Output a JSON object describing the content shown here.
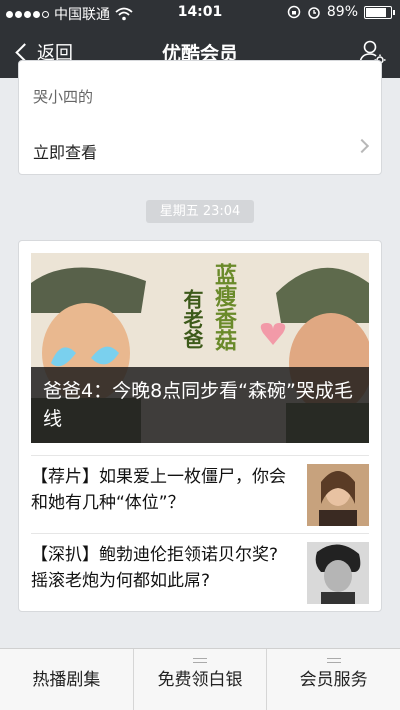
{
  "statusbar": {
    "carrier": "中国联通",
    "time": "14:01",
    "battery_text": "89%",
    "battery_level": 0.89,
    "icons": [
      "signal-dots-icon",
      "wifi-icon",
      "lock-rotation-icon",
      "alarm-icon",
      "battery-icon"
    ]
  },
  "navbar": {
    "back_label": "返回",
    "title": "优酷会员",
    "profile_icon": "user-settings-icon"
  },
  "message1": {
    "snippet": "哭小四的",
    "read_more": "立即查看"
  },
  "timestamp": "星期五 23:04",
  "message2": {
    "cover_title": "爸爸4：今晚8点同步看“森碗”哭成毛线",
    "cover_poster_text": "蓝瘦香菇",
    "cover_poster_text2": "有老爸",
    "items": [
      {
        "text": "【荐片】如果爱上一枚僵尸，你会和她有几种“体位”？",
        "thumb": "woman-portrait"
      },
      {
        "text": "【深扒】鲍勃迪伦拒领诺贝尔奖?摇滚老炮为何都如此屌?",
        "thumb": "man-portrait-bw"
      }
    ]
  },
  "bottom_menu": [
    "热播剧集",
    "免费领白银",
    "会员服务"
  ],
  "colors": {
    "nav_bg": "#2f3236",
    "page_bg": "#e9ebee",
    "card_bg": "#ffffff"
  }
}
